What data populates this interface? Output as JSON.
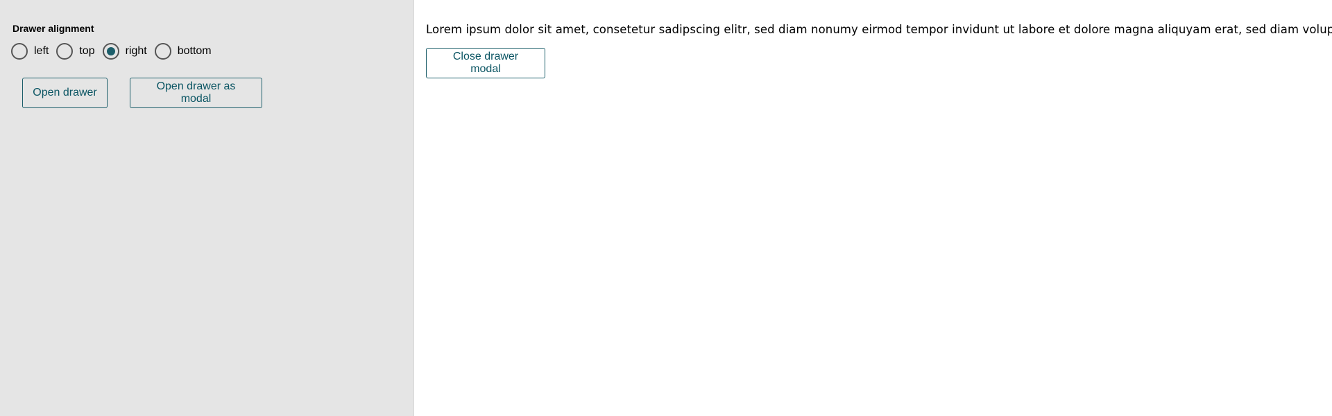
{
  "left_panel": {
    "group_label": "Drawer alignment",
    "options": [
      {
        "label": "left",
        "checked": false
      },
      {
        "label": "top",
        "checked": false
      },
      {
        "label": "right",
        "checked": true
      },
      {
        "label": "bottom",
        "checked": false
      }
    ],
    "open_drawer_label": "Open drawer",
    "open_drawer_modal_label": "Open drawer as modal"
  },
  "drawer": {
    "text": "Lorem ipsum dolor sit amet, consetetur sadipscing elitr, sed diam nonumy eirmod tempor invidunt ut labore et dolore magna aliquyam erat, sed diam voluptua.",
    "close_label": "Close drawer modal"
  },
  "colors": {
    "accent": "#1c5e6a",
    "panel_background": "#e5e5e5"
  }
}
